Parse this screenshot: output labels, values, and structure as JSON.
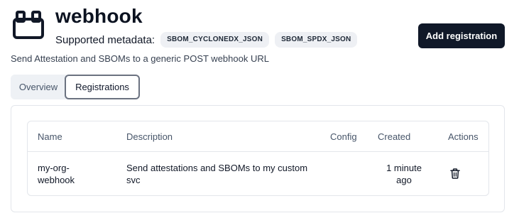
{
  "header": {
    "title": "webhook",
    "icon": "plugin-blocks-icon",
    "metadata_label": "Supported metadata:",
    "metadata_badges": [
      "SBOM_CYCLONEDX_JSON",
      "SBOM_SPDX_JSON"
    ],
    "description": "Send Attestation and SBOMs to a generic POST webhook URL",
    "add_button_label": "Add registration"
  },
  "tabs": [
    {
      "label": "Overview",
      "active": false
    },
    {
      "label": "Registrations",
      "active": true
    }
  ],
  "table": {
    "columns": [
      "Name",
      "Description",
      "Config",
      "Created",
      "Actions"
    ],
    "rows": [
      {
        "name_line1": "my-org-",
        "name_line2": "webhook",
        "description_line1": "Send attestations and SBOMs to my custom",
        "description_line2": "svc",
        "config": "",
        "created_line1": "1 minute",
        "created_line2": "ago",
        "action_icon": "trash-icon"
      }
    ]
  },
  "colors": {
    "primary_button": "#101828",
    "badge_bg": "#eef0f4",
    "tabs_bg": "#eef1f5",
    "border": "#e3e6eb"
  }
}
